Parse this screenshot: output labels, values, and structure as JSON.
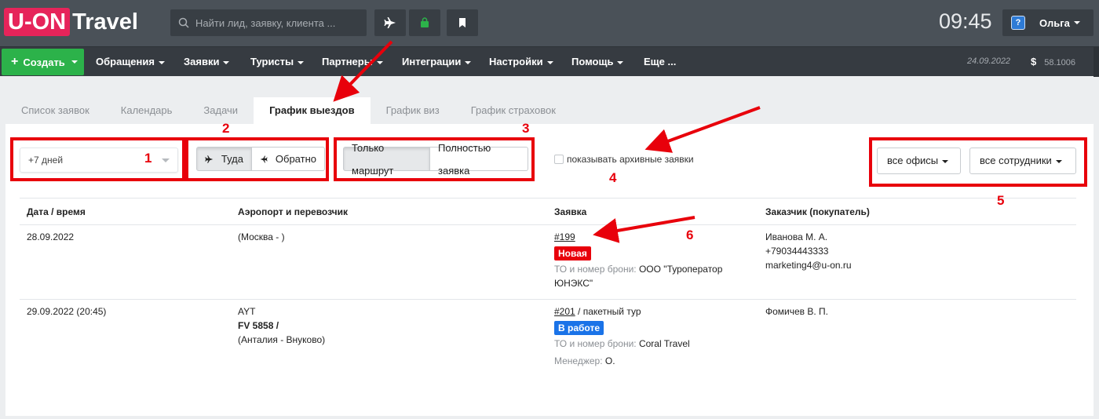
{
  "header": {
    "logo_primary": "U-ON",
    "logo_secondary": "Travel",
    "search_placeholder": "Найти лид, заявку, клиента ...",
    "clock": "09:45",
    "user_name": "Ольга",
    "user_avatar": "?"
  },
  "nav": {
    "create_label": "Создать",
    "items": [
      "Обращения",
      "Заявки",
      "Туристы",
      "Партнеры",
      "Интеграции",
      "Настройки",
      "Помощь",
      "Еще ..."
    ],
    "date": "24.09.2022",
    "currency_symbol": "$",
    "rate": "58.1006"
  },
  "tabs": [
    "Список заявок",
    "Календарь",
    "Задачи",
    "График выездов",
    "График виз",
    "График страховок"
  ],
  "active_tab_index": 3,
  "filters": {
    "period_value": "+7 дней",
    "direction_there": "Туда",
    "direction_back": "Обратно",
    "mode_route": "Только маршрут",
    "mode_full": "Полностью заявка",
    "show_archive": "показывать архивные заявки",
    "offices": "все офисы",
    "employees": "все сотрудники"
  },
  "table": {
    "headers": [
      "Дата / время",
      "Аэропорт и перевозчик",
      "Заявка",
      "Заказчик (покупатель)"
    ],
    "rows": [
      {
        "date": "28.09.2022",
        "airport_line1": "(Москва - )",
        "request_id": "#199",
        "request_type": "",
        "status": "Новая",
        "status_color": "#e8000b",
        "to_label": "ТО и номер брони:",
        "to_value": "ООО \"Туроператор",
        "to_value_2": "ЮНЭКС\"",
        "customer_name": "Иванова М. А.",
        "customer_phone": "+79034443333",
        "customer_email": "marketing4@u-on.ru"
      },
      {
        "date": "29.09.2022 (20:45)",
        "airport_line1": "AYT",
        "airport_line2": "FV 5858 /",
        "airport_line3": "(Анталия - Внуково)",
        "request_id": "#201",
        "request_type": "/ пакетный тур",
        "status": "В работе",
        "status_color": "#1a73e8",
        "to_label": "ТО и номер брони:",
        "to_value": "Coral Travel",
        "manager_label": "Менеджер:",
        "manager_value": "О.",
        "customer_name": "Фомичев В. П."
      }
    ]
  },
  "annotations": [
    "1",
    "2",
    "3",
    "4",
    "5",
    "6"
  ],
  "colors": {
    "annotation": "#e8000b",
    "create_button": "#2cb24a",
    "logo": "#e6245a"
  }
}
